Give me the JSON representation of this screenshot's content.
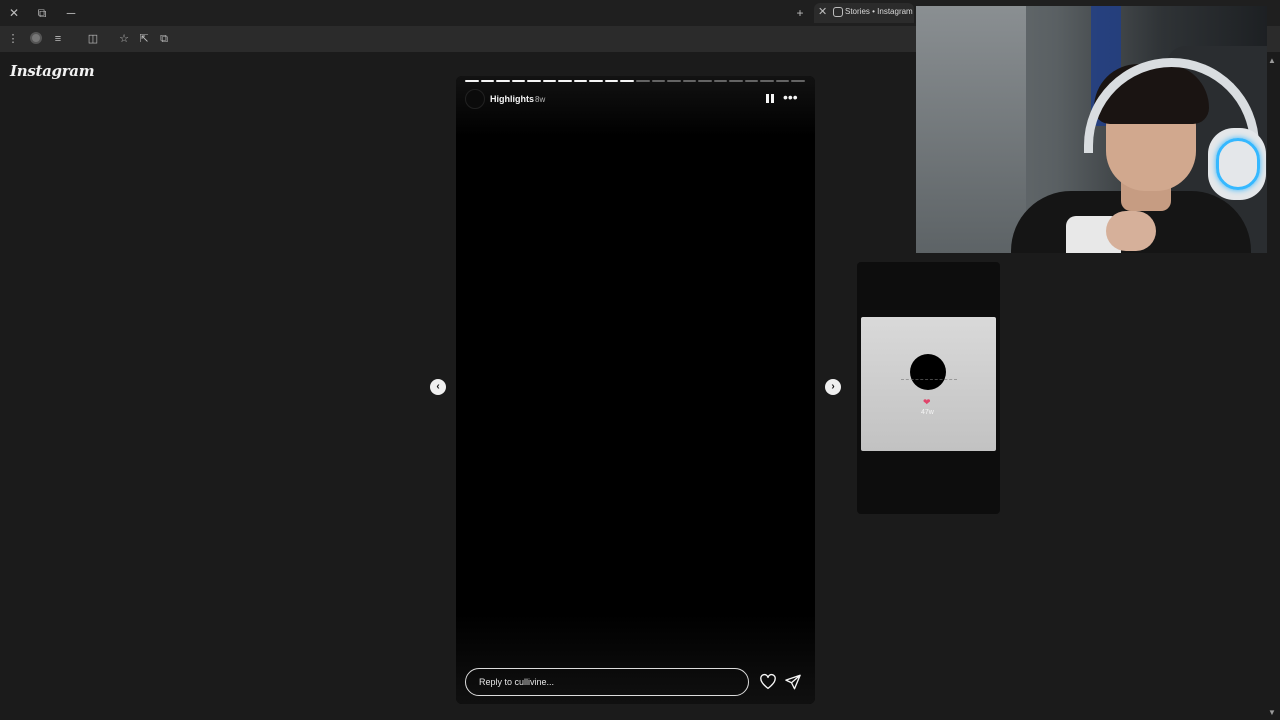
{
  "browser": {
    "tab_title": "Stories • Instagram",
    "new_tab_label": "+",
    "close_glyph": "✕",
    "window_controls": {
      "close": "✕",
      "restore": "⧉",
      "minimize": "─"
    }
  },
  "page": {
    "logo": "Instagram"
  },
  "story": {
    "username": "Highlights",
    "timestamp": "8w",
    "segments_total": 22,
    "segments_done": 11,
    "reply_placeholder": "Reply to cullivine...",
    "icons": {
      "pause": "pause-icon",
      "more": "more-options-icon",
      "like": "heart-icon",
      "share": "send-icon"
    }
  },
  "navigation": {
    "prev_glyph": "‹",
    "next_glyph": "›"
  },
  "next_preview": {
    "heart": "❤",
    "timestamp": "47w",
    "accent": "#e0446a"
  },
  "colors": {
    "background": "#1b1b1b",
    "story_bg": "#000000",
    "headset_ring": "#35b8ff"
  }
}
